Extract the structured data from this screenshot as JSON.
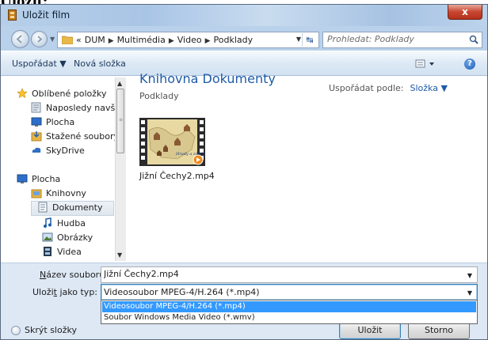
{
  "page_heading": "Uložit:",
  "window": {
    "title": "Uložit film",
    "close_label": "x"
  },
  "nav": {
    "breadcrumbs": [
      "«",
      "DUM",
      "Multimédia",
      "Video",
      "Podklady"
    ],
    "search_placeholder": "Prohledat: Podklady"
  },
  "toolbar": {
    "organize_label": "Uspořádat ▼",
    "new_folder_label": "Nová složka",
    "help_label": "?"
  },
  "sidebar": {
    "items": [
      {
        "label": "Oblíbené položky",
        "icon": "star-icon"
      },
      {
        "label": "Naposledy navštívené",
        "icon": "recent-places-icon"
      },
      {
        "label": "Plocha",
        "icon": "desktop-icon"
      },
      {
        "label": "Stažené soubory",
        "icon": "downloads-icon"
      },
      {
        "label": "SkyDrive",
        "icon": "skydrive-icon"
      },
      {
        "label": "Plocha",
        "icon": "desktop-icon"
      },
      {
        "label": "Knihovny",
        "icon": "libraries-icon"
      },
      {
        "label": "Dokumenty",
        "icon": "documents-icon",
        "selected": true
      },
      {
        "label": "Hudba",
        "icon": "music-icon"
      },
      {
        "label": "Obrázky",
        "icon": "pictures-icon"
      },
      {
        "label": "Videa",
        "icon": "videos-icon"
      }
    ]
  },
  "main": {
    "library_title": "Knihovna Dokumenty",
    "library_subtitle": "Podklady",
    "arrange_label": "Uspořádat podle:",
    "arrange_value": "Složka ▼",
    "files": [
      {
        "name": "Jižní Čechy2.mp4",
        "thumb_caption": "Hrady a zámky jižních Čech"
      }
    ]
  },
  "bottom": {
    "filename_label_pre": "",
    "filename_label_u": "N",
    "filename_label_post": "ázev souboru:",
    "filename_value": "Jižní Čechy2.mp4",
    "type_label_pre": "Uloži",
    "type_label_u": "t",
    "type_label_post": " jako typ:",
    "type_selected": "Videosoubor MPEG-4/H.264 (*.mp4)",
    "type_options": [
      "Videosoubor MPEG-4/H.264 (*.mp4)",
      "Soubor Windows Media Video (*.wmv)"
    ],
    "hide_folders_label": "Skrýt složky",
    "save_button": "Uložit",
    "cancel_button": "Storno"
  },
  "colors": {
    "accent_blue": "#1e5ba8",
    "selection_blue": "#3399ff",
    "close_red": "#c8452f"
  }
}
